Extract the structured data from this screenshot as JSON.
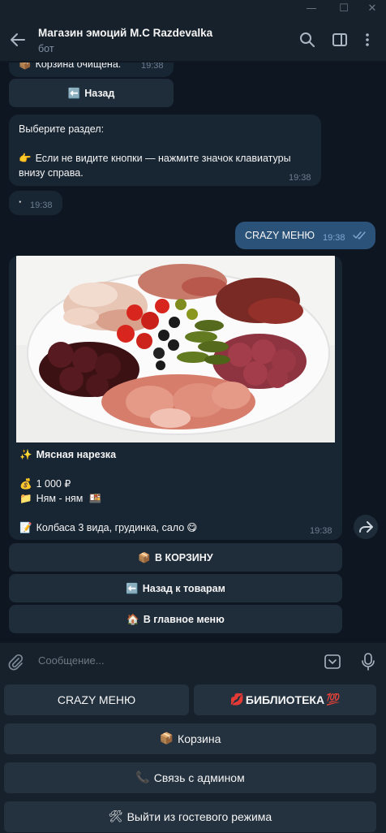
{
  "window": {
    "minimize_glyph": "—",
    "maximize_glyph": "☐",
    "close_glyph": "✕"
  },
  "header": {
    "title": "Магазин эмоций M.C Razdevalka",
    "subtitle": "бот",
    "icons": [
      "back-arrow-icon",
      "search-icon",
      "sidebar-toggle-icon",
      "more-vertical-icon"
    ]
  },
  "messages": {
    "cart_cleared": {
      "emoji": "📦",
      "text": "Корзина очищена.",
      "time": "19:38"
    },
    "back_button": {
      "emoji": "⬅️",
      "label": "Назад"
    },
    "choose_section": {
      "line1": "Выберите раздел:",
      "line2_emoji": "👉",
      "line2": "Если не видите кнопки — нажмите значок клавиатуры",
      "line3": "внизу справа.",
      "time": "19:38"
    },
    "dot_message": {
      "text": "·",
      "time": "19:38"
    },
    "outgoing": {
      "text": "CRAZY МЕНЮ",
      "time": "19:38",
      "status": "read"
    },
    "product": {
      "title_emoji": "✨",
      "title": "Мясная нарезка",
      "price_emoji": "💰",
      "price": "1 000 ₽",
      "category_emoji": "📁",
      "category": "Ням - ням",
      "category_suffix_emoji": "🍱",
      "desc_emoji": "📝",
      "description": "Колбаса 3 вида, грудинка, сало",
      "desc_suffix_emoji": "😋",
      "time": "19:38",
      "photo_alt": "meat-platter-photo"
    },
    "inline_buttons": [
      {
        "emoji": "📦",
        "label": "В КОРЗИНУ"
      },
      {
        "emoji": "⬅️",
        "label": "Назад к товарам"
      },
      {
        "emoji": "🏠",
        "label": "В главное меню"
      }
    ]
  },
  "input": {
    "placeholder": "Сообщение..."
  },
  "reply_keyboard": {
    "crazy_menu": "CRAZY МЕНЮ",
    "library": {
      "emoji_before": "💋",
      "label": "БИБЛИОТЕКА",
      "emoji_after": "💯"
    },
    "cart": {
      "emoji": "📦",
      "label": "Корзина"
    },
    "admin": {
      "emoji": "📞",
      "label": "Связь с админом"
    },
    "exit_guest": {
      "emoji": "🛠",
      "label": "Выйти из гостевого режима"
    }
  },
  "colors": {
    "chat_bg": "#0e1621",
    "bubble_in": "#182533",
    "bubble_out": "#2b5278",
    "panel": "#17212b",
    "key_bg": "#243240",
    "accent": "#5eb5f7"
  }
}
